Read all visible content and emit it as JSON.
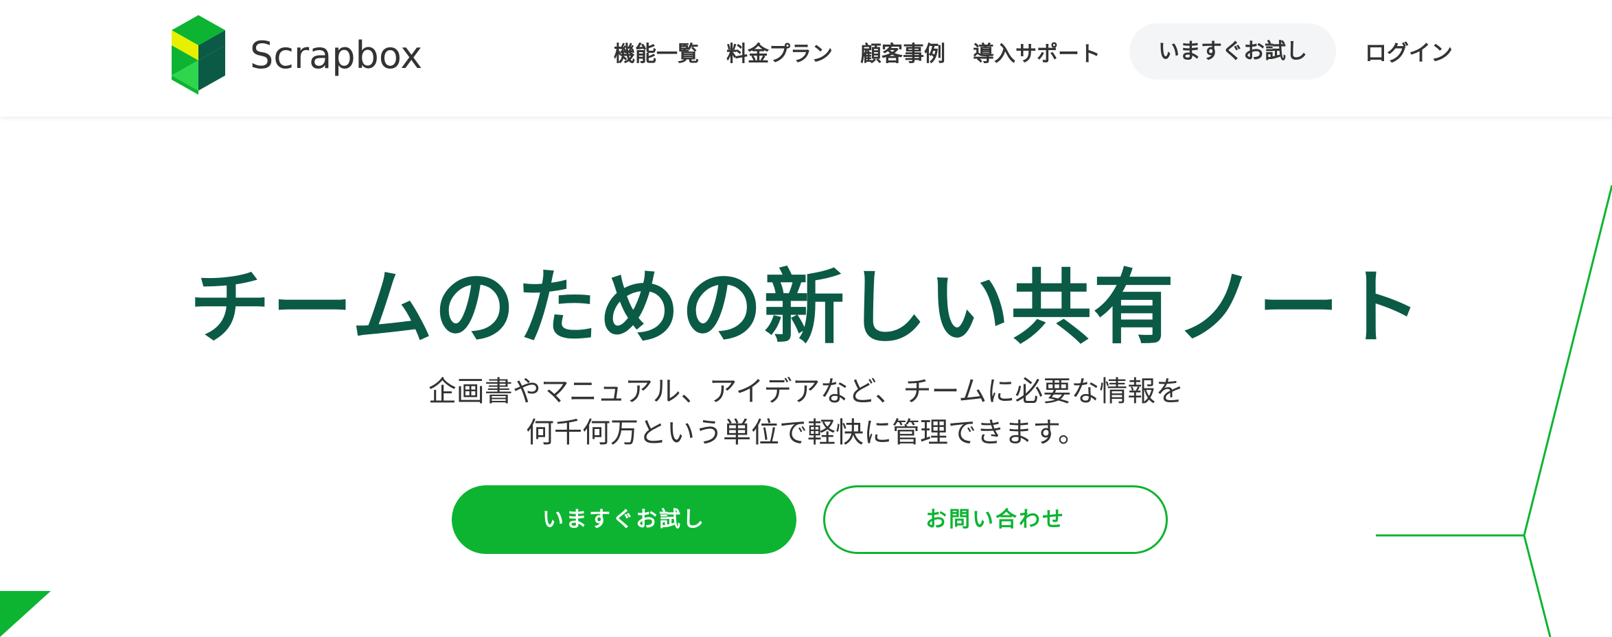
{
  "brand": {
    "name": "Scrapbox",
    "logo_icon": "scrapbox-logo-icon",
    "colors": {
      "accent": "#0db432",
      "dark_green": "#0b5a45",
      "light_green": "#2fd64d",
      "yellow": "#e8f000",
      "text": "#333333"
    }
  },
  "nav": {
    "items": [
      {
        "label": "機能一覧"
      },
      {
        "label": "料金プラン"
      },
      {
        "label": "顧客事例"
      },
      {
        "label": "導入サポート"
      }
    ],
    "try_label": "いますぐお試し",
    "login_label": "ログイン"
  },
  "hero": {
    "title": "チームのための新しい共有ノート",
    "subtitle_line1": "企画書やマニュアル、アイデアなど、チームに必要な情報を",
    "subtitle_line2": "何千何万という単位で軽快に管理できます。",
    "primary_button": "いますぐお試し",
    "secondary_button": "お問い合わせ"
  }
}
